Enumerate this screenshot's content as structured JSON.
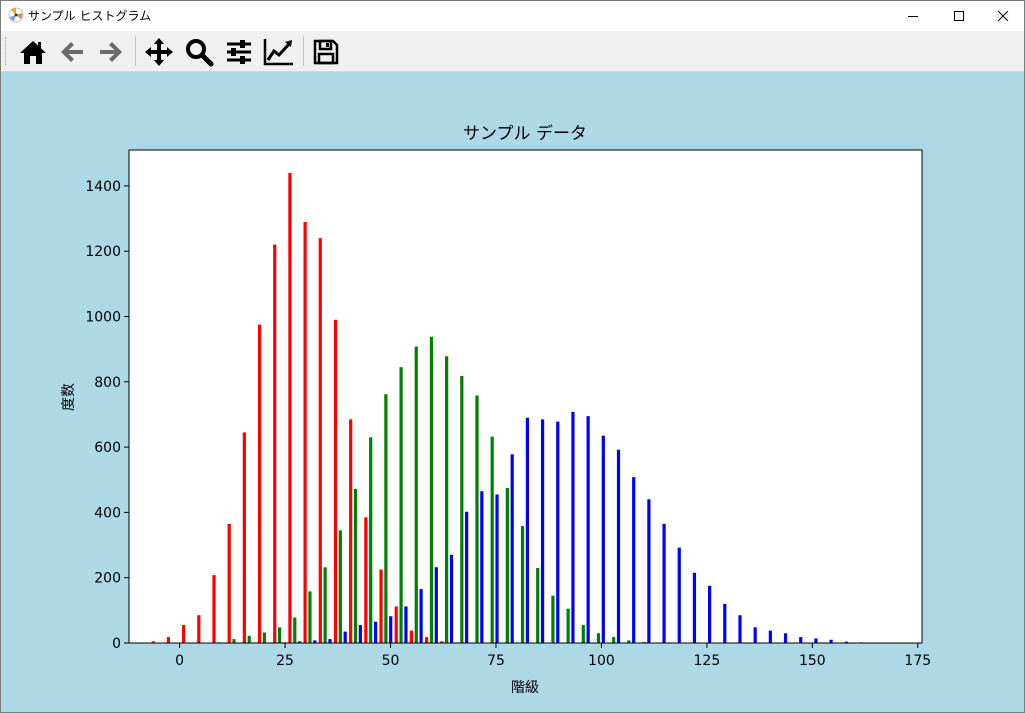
{
  "window": {
    "title": "サンプル ヒストグラム",
    "app_icon": "matplotlib-icon",
    "controls": [
      "minimize-icon",
      "maximize-icon",
      "close-icon"
    ]
  },
  "toolbar": {
    "buttons": [
      "home-icon",
      "back-arrow-icon",
      "forward-arrow-icon",
      "pan-icon",
      "zoom-icon",
      "configure-subplots-icon",
      "edit-axis-icon",
      "save-icon"
    ]
  },
  "colors": {
    "background": "#add8e6",
    "series1": "#ff0000",
    "series2": "#008000",
    "series3": "#0000ff"
  },
  "chart_data": {
    "type": "bar",
    "title": "サンプル データ",
    "xlabel": "階級",
    "ylabel": "度数",
    "xlim": [
      -12,
      176
    ],
    "ylim": [
      0,
      1510
    ],
    "xticks": [
      0,
      25,
      50,
      75,
      100,
      125,
      150,
      175
    ],
    "yticks": [
      0,
      200,
      400,
      600,
      800,
      1000,
      1200,
      1400
    ],
    "grid": false,
    "legend": "none",
    "x": [
      -5.1,
      -1.5,
      2.1,
      5.7,
      9.3,
      12.9,
      16.5,
      20.1,
      23.7,
      27.3,
      30.9,
      34.5,
      38.1,
      41.7,
      45.3,
      48.9,
      52.5,
      56.1,
      59.7,
      63.3,
      66.9,
      70.5,
      74.1,
      77.7,
      81.3,
      84.9,
      88.5,
      92.1,
      95.7,
      99.3,
      102.9,
      106.5,
      110.1,
      113.7,
      117.3,
      120.9,
      124.5,
      128.1,
      131.7,
      135.3,
      138.9,
      142.5,
      146.1,
      149.7,
      153.3,
      156.9,
      160.5,
      164.1
    ],
    "series": [
      {
        "color": "#ff0000",
        "values": [
          5,
          18,
          55,
          85,
          208,
          365,
          645,
          975,
          1220,
          1440,
          1290,
          1240,
          990,
          685,
          385,
          225,
          112,
          38,
          18,
          5,
          2,
          0,
          0,
          0,
          0,
          0,
          0,
          0,
          0,
          0,
          0,
          0,
          0,
          0,
          0,
          0,
          0,
          0,
          0,
          0,
          0,
          0,
          0,
          0,
          0,
          0,
          0,
          0
        ]
      },
      {
        "color": "#008000",
        "values": [
          0,
          0,
          0,
          0,
          2,
          12,
          22,
          32,
          48,
          78,
          158,
          232,
          345,
          472,
          630,
          762,
          845,
          908,
          938,
          878,
          818,
          758,
          632,
          475,
          358,
          230,
          145,
          105,
          55,
          30,
          18,
          8,
          3,
          1,
          0,
          0,
          0,
          0,
          0,
          0,
          0,
          0,
          0,
          0,
          0,
          0,
          0,
          0
        ]
      },
      {
        "color": "#0000ff",
        "values": [
          0,
          0,
          0,
          0,
          0,
          0,
          0,
          0,
          2,
          5,
          8,
          12,
          35,
          55,
          65,
          82,
          112,
          165,
          232,
          270,
          402,
          465,
          455,
          578,
          690,
          685,
          678,
          708,
          695,
          635,
          592,
          508,
          440,
          365,
          292,
          215,
          175,
          120,
          85,
          48,
          38,
          30,
          18,
          14,
          10,
          4,
          2,
          1
        ]
      }
    ]
  }
}
